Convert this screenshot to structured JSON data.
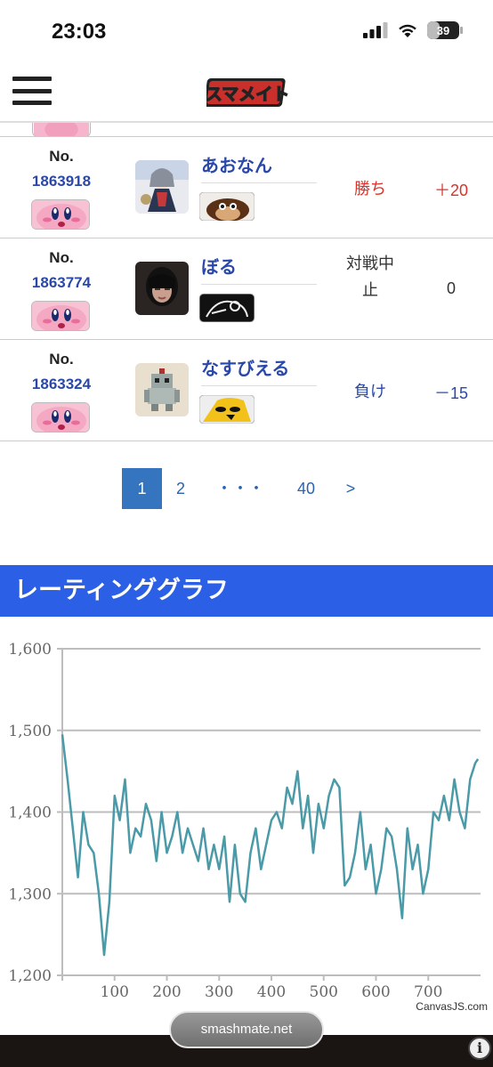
{
  "status_bar": {
    "time": "23:03",
    "battery": "39",
    "battery_level": 0.39
  },
  "header": {
    "logo_text": "スマメイト",
    "menu_icon": "hamburger-icon"
  },
  "matches": [
    {
      "no_label": "No.",
      "number": "1863918",
      "opponent": "あおなん",
      "result": "勝ち",
      "delta": "＋20",
      "result_color": "#d8322a",
      "delta_color": "#d8322a"
    },
    {
      "no_label": "No.",
      "number": "1863774",
      "opponent": "ぼる",
      "result": "対戦中止",
      "delta": "0",
      "result_color": "#333333",
      "delta_color": "#333333"
    },
    {
      "no_label": "No.",
      "number": "1863324",
      "opponent": "なすびえる",
      "result": "負け",
      "delta": "－15",
      "result_color": "#2a48a8",
      "delta_color": "#2a48a8"
    }
  ],
  "pagination": {
    "items": [
      "1",
      "2",
      "・・・",
      "40",
      ">"
    ],
    "active": "1"
  },
  "rating_section": {
    "title": "レーティンググラフ"
  },
  "chart_data": {
    "type": "line",
    "ylim": [
      1200,
      1600
    ],
    "y_ticks": [
      "1,200",
      "1,300",
      "1,400",
      "1,500",
      "1,600"
    ],
    "x_ticks": [
      "100",
      "200",
      "300",
      "400",
      "500",
      "600",
      "700"
    ],
    "xlim": [
      0,
      800
    ],
    "color": "#4a9aa8",
    "x": [
      0,
      10,
      20,
      30,
      40,
      50,
      60,
      70,
      80,
      90,
      100,
      110,
      120,
      130,
      140,
      150,
      160,
      170,
      180,
      190,
      200,
      210,
      220,
      230,
      240,
      250,
      260,
      270,
      280,
      290,
      300,
      310,
      320,
      330,
      340,
      350,
      360,
      370,
      380,
      390,
      400,
      410,
      420,
      430,
      440,
      450,
      460,
      470,
      480,
      490,
      500,
      510,
      520,
      530,
      540,
      550,
      560,
      570,
      580,
      590,
      600,
      610,
      620,
      630,
      640,
      650,
      660,
      670,
      680,
      690,
      700,
      710,
      720,
      730,
      740,
      750,
      760,
      770,
      780,
      790,
      795
    ],
    "values": [
      1495,
      1440,
      1380,
      1320,
      1400,
      1360,
      1350,
      1300,
      1225,
      1290,
      1420,
      1390,
      1440,
      1350,
      1380,
      1370,
      1410,
      1390,
      1340,
      1400,
      1350,
      1370,
      1400,
      1350,
      1380,
      1360,
      1340,
      1380,
      1330,
      1360,
      1330,
      1370,
      1290,
      1360,
      1300,
      1290,
      1350,
      1380,
      1330,
      1360,
      1390,
      1400,
      1380,
      1430,
      1410,
      1450,
      1380,
      1420,
      1350,
      1410,
      1380,
      1420,
      1440,
      1430,
      1310,
      1320,
      1350,
      1400,
      1330,
      1360,
      1300,
      1330,
      1380,
      1370,
      1330,
      1270,
      1380,
      1330,
      1360,
      1300,
      1330,
      1400,
      1390,
      1420,
      1390,
      1440,
      1400,
      1380,
      1440,
      1460,
      1465
    ],
    "grid": true,
    "credit": "CanvasJS.com"
  },
  "browser": {
    "url": "smashmate.net"
  }
}
